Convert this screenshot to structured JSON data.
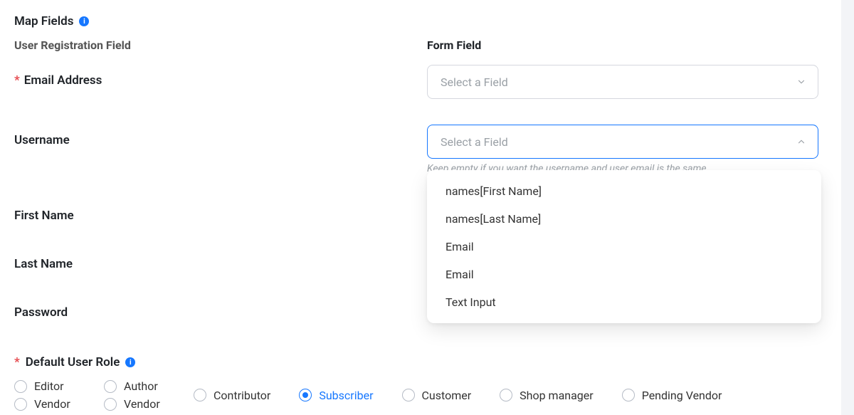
{
  "section": {
    "title": "Map Fields"
  },
  "columns": {
    "user_reg": "User Registration Field",
    "form_field": "Form Field"
  },
  "fields": {
    "email": {
      "label": "Email Address",
      "required": true,
      "placeholder": "Select a Field"
    },
    "username": {
      "label": "Username",
      "required": false,
      "placeholder": "Select a Field",
      "helper": "Keep empty if you want the username and user email is the same"
    },
    "first_name": {
      "label": "First Name",
      "required": false
    },
    "last_name": {
      "label": "Last Name",
      "required": false
    },
    "password": {
      "label": "Password",
      "required": false
    }
  },
  "username_dropdown": {
    "options": [
      "names[First Name]",
      "names[Last Name]",
      "Email",
      "Email",
      "Text Input"
    ]
  },
  "default_role": {
    "title": "Default User Role",
    "required": true,
    "selected": "Subscriber",
    "options": [
      "Editor",
      "Vendor",
      "Author",
      "Vendor",
      "Contributor",
      "Subscriber",
      "Customer",
      "Shop manager",
      "Pending Vendor"
    ]
  }
}
